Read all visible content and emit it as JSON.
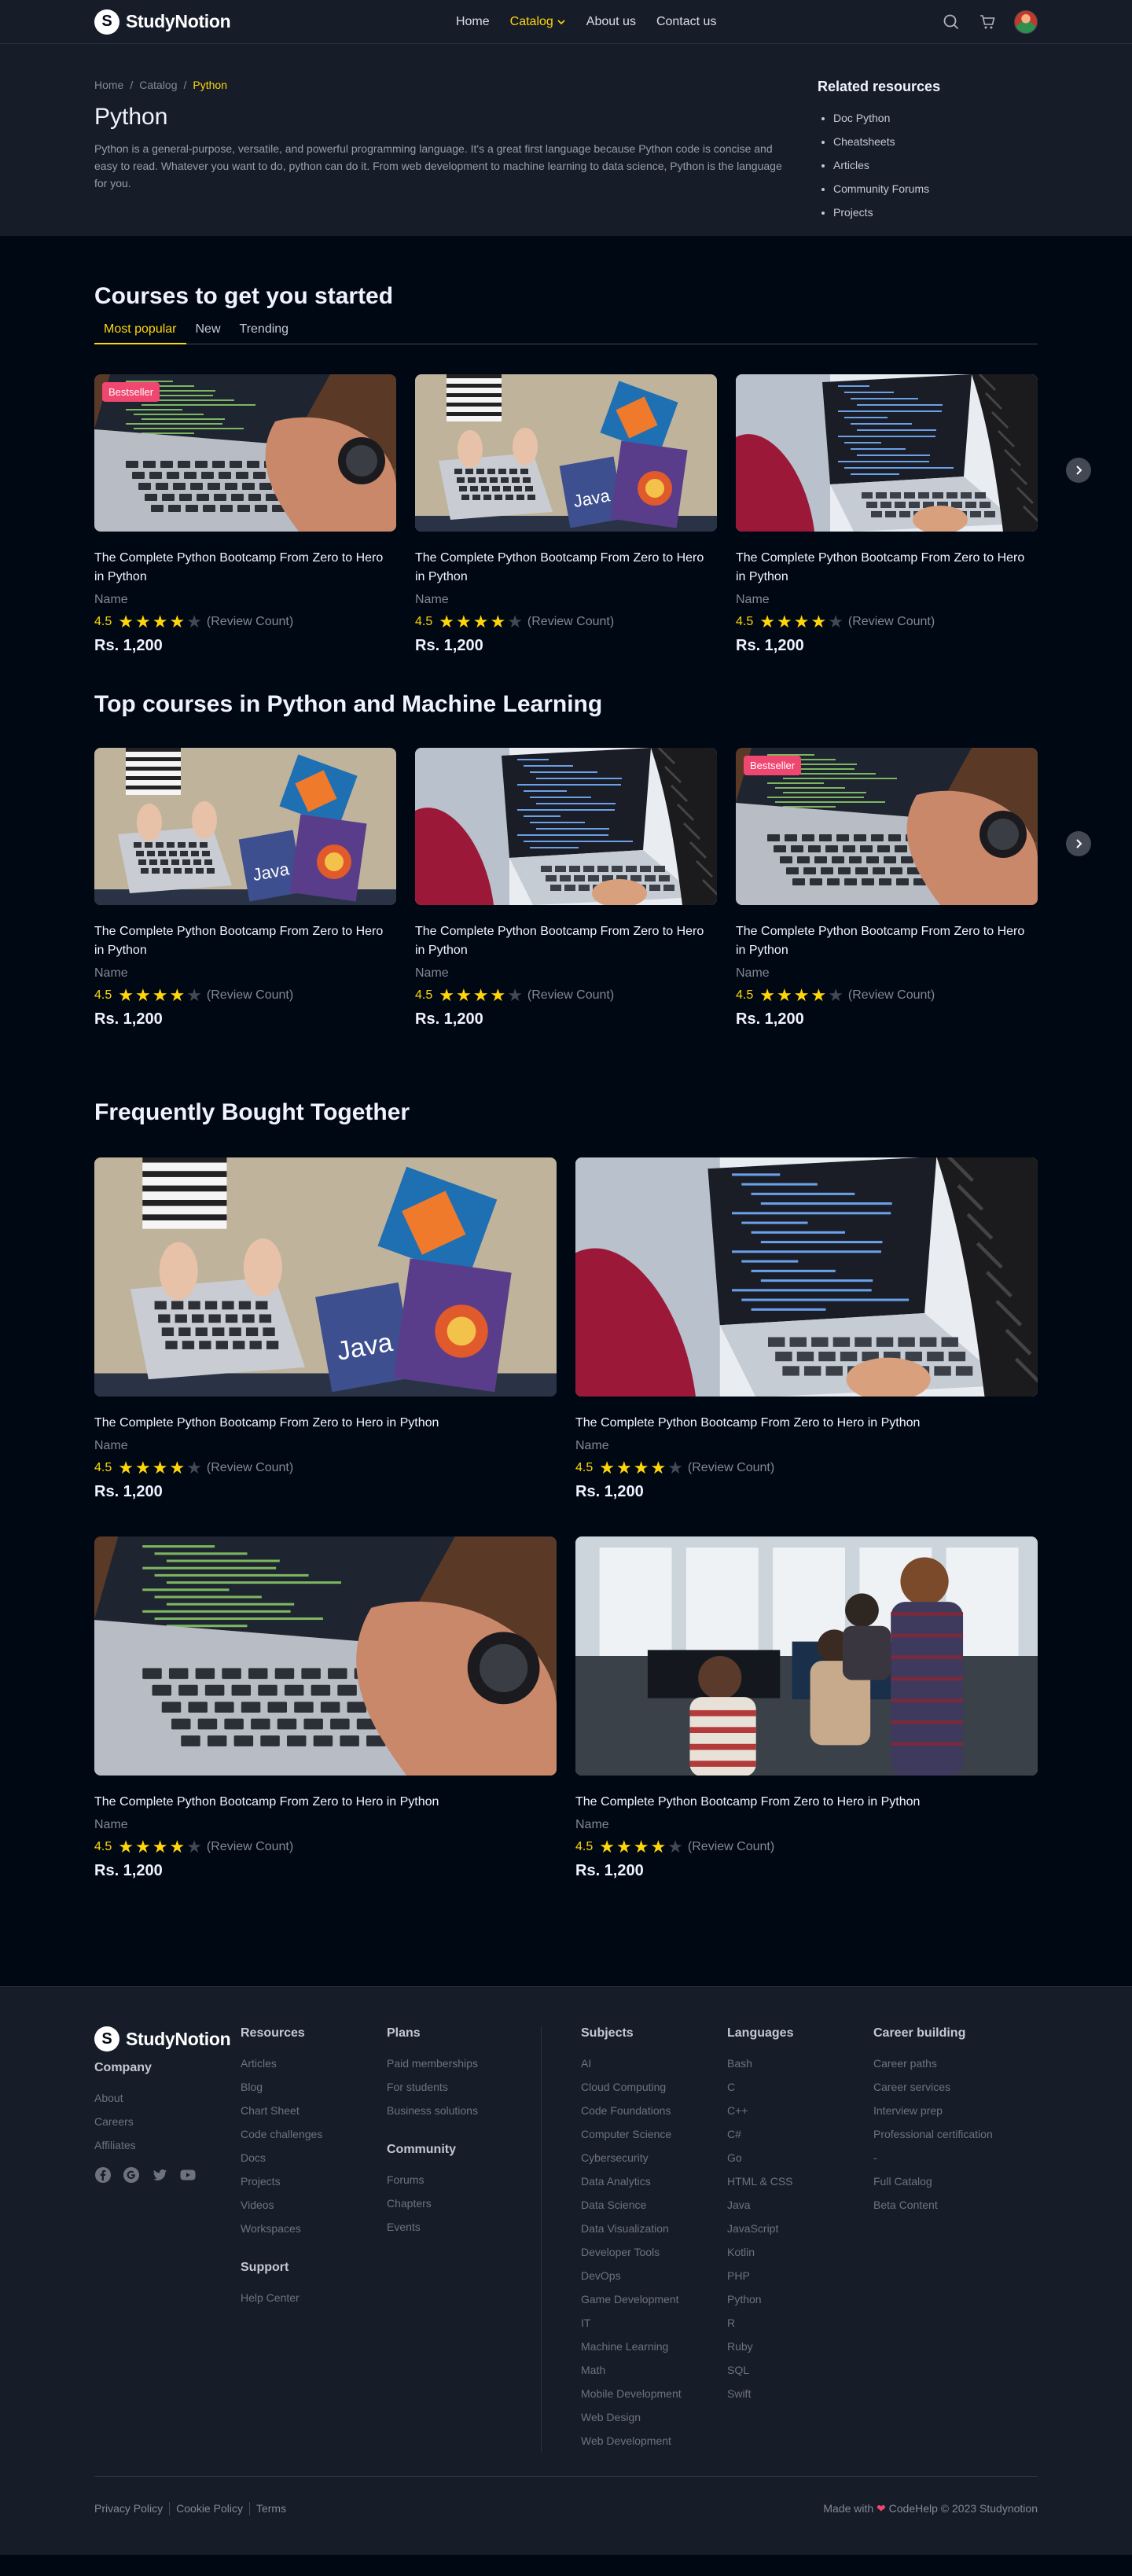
{
  "nav": {
    "brand": "StudyNotion",
    "links": [
      "Home",
      "Catalog",
      "About us",
      "Contact us"
    ]
  },
  "hero": {
    "breadcrumb": [
      "Home",
      "Catalog",
      "Python"
    ],
    "title": "Python",
    "description": "Python is a general-purpose, versatile, and powerful programming language. It's a great first language because Python code is concise and easy to read. Whatever you want to do, python can do it. From web development to machine learning to data science, Python is the language for you.",
    "related_title": "Related resources",
    "related": [
      "Doc Python",
      "Cheatsheets",
      "Articles",
      "Community Forums",
      "Projects"
    ]
  },
  "sections": {
    "started_title": "Courses to get you started",
    "tabs": [
      "Most popular",
      "New",
      "Trending"
    ],
    "top_title": "Top courses in Python and Machine Learning",
    "fbt_title": "Frequently Bought Together"
  },
  "course": {
    "title": "The Complete Python Bootcamp From Zero to Hero in Python",
    "name": "Name",
    "rating": "4.5",
    "rating_value": 4,
    "review": "(Review Count)",
    "price": "Rs. 1,200",
    "badge": "Bestseller"
  },
  "footer": {
    "brand": "StudyNotion",
    "company_title": "Company",
    "company": [
      "About",
      "Careers",
      "Affiliates"
    ],
    "resources_title": "Resources",
    "resources": [
      "Articles",
      "Blog",
      "Chart Sheet",
      "Code challenges",
      "Docs",
      "Projects",
      "Videos",
      "Workspaces"
    ],
    "support_title": "Support",
    "support": [
      "Help Center"
    ],
    "plans_title": "Plans",
    "plans": [
      "Paid memberships",
      "For students",
      "Business solutions"
    ],
    "community_title": "Community",
    "community": [
      "Forums",
      "Chapters",
      "Events"
    ],
    "subjects_title": "Subjects",
    "subjects": [
      "AI",
      "Cloud Computing",
      "Code Foundations",
      "Computer Science",
      "Cybersecurity",
      "Data Analytics",
      "Data Science",
      "Data Visualization",
      "Developer Tools",
      "DevOps",
      "Game Development",
      "IT",
      "Machine Learning",
      "Math",
      "Mobile Development",
      "Web Design",
      "Web Development"
    ],
    "languages_title": "Languages",
    "languages": [
      "Bash",
      "C",
      "C++",
      "C#",
      "Go",
      "HTML & CSS",
      "Java",
      "JavaScript",
      "Kotlin",
      "PHP",
      "Python",
      "R",
      "Ruby",
      "SQL",
      "Swift"
    ],
    "career_title": "Career building",
    "career": [
      "Career paths",
      "Career services",
      "Interview prep",
      "Professional certification",
      "-",
      "Full Catalog",
      "Beta Content"
    ],
    "bottom_links": [
      "Privacy Policy",
      "Cookie Policy",
      "Terms"
    ],
    "made_with_pre": "Made with",
    "made_with_post": "CodeHelp © 2023 Studynotion"
  },
  "colors": {
    "accent": "#ffd60a",
    "badge": "#ef476f",
    "page_bg": "#000814",
    "panel_bg": "#161d29"
  }
}
